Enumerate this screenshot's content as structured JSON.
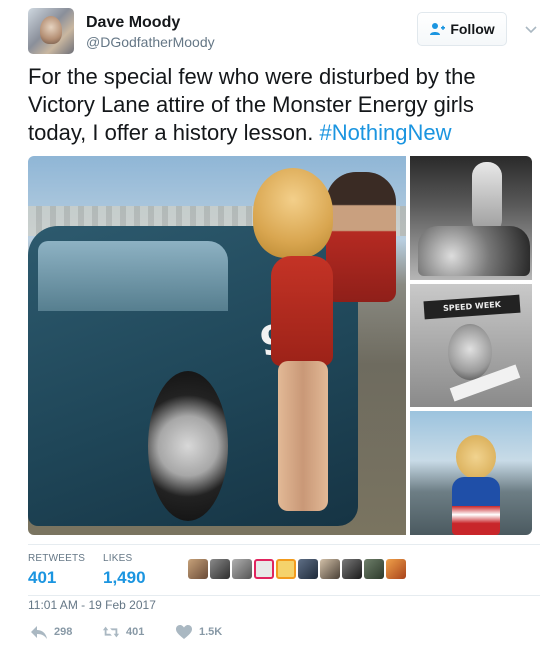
{
  "author": {
    "name": "Dave Moody",
    "handle": "@DGodfatherMoody",
    "avatar_icon": "user-avatar"
  },
  "follow_button": {
    "label": "Follow",
    "icon": "add-person-icon",
    "color": "#1b95e0"
  },
  "menu": {
    "icon": "chevron-down-icon"
  },
  "tweet": {
    "text": "For the special few who were disturbed by the Victory Lane attire of the Monster Energy girls today, I offer a history lesson. ",
    "hashtag": "#NothingNew",
    "hashtag_color": "#1b95e0"
  },
  "media": {
    "main_photo_number": "91",
    "side_photo_2_sign": "SPEED WEEK"
  },
  "stats": {
    "retweets_label": "RETWEETS",
    "retweets_value": "401",
    "likes_label": "LIKES",
    "likes_value": "1,490",
    "likers": [
      "liker-avatar-1",
      "liker-avatar-2",
      "liker-avatar-3",
      "liker-avatar-4",
      "liker-avatar-5",
      "liker-avatar-6",
      "liker-avatar-7",
      "liker-avatar-8",
      "liker-avatar-9",
      "liker-avatar-10"
    ]
  },
  "timestamp": "11:01 AM - 19 Feb 2017",
  "actions": {
    "reply": {
      "icon": "reply-icon",
      "count": "298"
    },
    "retweet": {
      "icon": "retweet-icon",
      "count": "401"
    },
    "like": {
      "icon": "heart-icon",
      "count": "1.5K"
    },
    "color": "#8899a6"
  }
}
